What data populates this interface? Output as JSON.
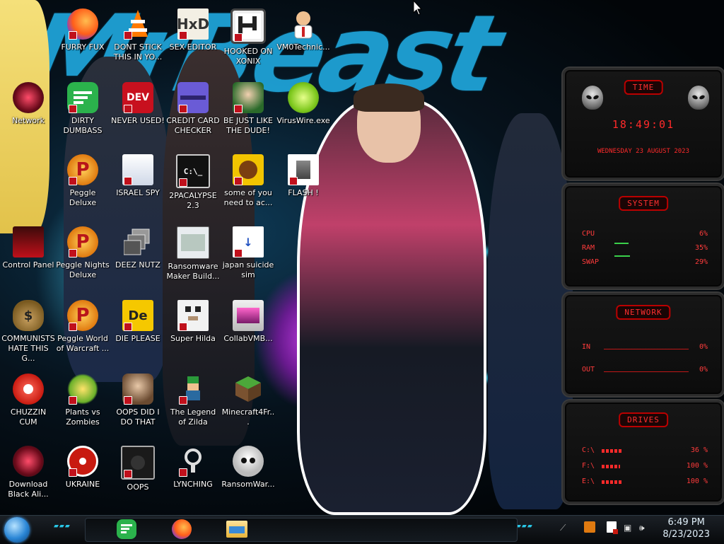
{
  "desktop": {
    "icons": [
      {
        "id": "furry-fux",
        "label": "FURRY FUX"
      },
      {
        "id": "dont-stick",
        "label": "DONT STICK THIS IN YO..."
      },
      {
        "id": "sex-editor",
        "label": "SEX EDITOR"
      },
      {
        "id": "hooked-on-xonix",
        "label": "HOOKED ON XONIX"
      },
      {
        "id": "vm0technic",
        "label": "VM0Technic..."
      },
      {
        "id": "network",
        "label": "Network"
      },
      {
        "id": "dirty-dumbass",
        "label": "DIRTY DUMBASS"
      },
      {
        "id": "never-used",
        "label": "NEVER USED!"
      },
      {
        "id": "credit-card-checker",
        "label": "CREDIT CARD CHECKER"
      },
      {
        "id": "be-just-like-the-dude",
        "label": "BE JUST LIKE THE DUDE!"
      },
      {
        "id": "viruswire",
        "label": "VirusWire.exe"
      },
      {
        "id": "peggle-deluxe",
        "label": "Peggle Deluxe"
      },
      {
        "id": "israel-spy",
        "label": "ISRAEL SPY"
      },
      {
        "id": "2pacalypse",
        "label": "2PACALYPSE 2.3"
      },
      {
        "id": "some-of-you",
        "label": "some of you need to ac..."
      },
      {
        "id": "flash",
        "label": "FLASH !"
      },
      {
        "id": "control-panel",
        "label": "Control Panel"
      },
      {
        "id": "peggle-nights",
        "label": "Peggle Nights Deluxe"
      },
      {
        "id": "deez-nutz",
        "label": "DEEZ NUTZ"
      },
      {
        "id": "ransomware-maker",
        "label": "Ransomware Maker Build..."
      },
      {
        "id": "japan-suicide-sim",
        "label": "japan suicide sim"
      },
      {
        "id": "communists",
        "label": "COMMUNISTS HATE THIS G..."
      },
      {
        "id": "peggle-world",
        "label": "Peggle World of Warcraft ..."
      },
      {
        "id": "die-please",
        "label": "DIE PLEASE"
      },
      {
        "id": "super-hilda",
        "label": "Super Hilda"
      },
      {
        "id": "collabvmb",
        "label": "CollabVMB..."
      },
      {
        "id": "chuzzin-cum",
        "label": "CHUZZIN CUM"
      },
      {
        "id": "plants-vs-zombies",
        "label": "Plants vs Zombies"
      },
      {
        "id": "oops-did-i",
        "label": "OOPS DID I DO THAT"
      },
      {
        "id": "legend-of-zilda",
        "label": "The Legend of Zilda"
      },
      {
        "id": "minecraft4fr",
        "label": "Minecraft4Fr..."
      },
      {
        "id": "download-black-ali",
        "label": "Download Black Ali..."
      },
      {
        "id": "ukraine",
        "label": "UKRAINE"
      },
      {
        "id": "oops",
        "label": "OOPS"
      },
      {
        "id": "lynching",
        "label": "LYNCHING"
      },
      {
        "id": "ransomwar",
        "label": "RansomWar..."
      }
    ]
  },
  "widgets": {
    "time": {
      "title": "TIME",
      "clock": "18:49:01",
      "date": "WEDNESDAY 23 AUGUST 2023"
    },
    "system": {
      "title": "SYSTEM",
      "rows": [
        {
          "label": "CPU",
          "value": "6%"
        },
        {
          "label": "RAM",
          "value": "35%"
        },
        {
          "label": "SWAP",
          "value": "29%"
        }
      ]
    },
    "network": {
      "title": "NETWORK",
      "rows": [
        {
          "label": "IN",
          "value": "0%"
        },
        {
          "label": "OUT",
          "value": "0%"
        }
      ]
    },
    "drives": {
      "title": "DRIVES",
      "rows": [
        {
          "label": "C:\\",
          "value": "36 %"
        },
        {
          "label": "F:\\",
          "value": "100 %"
        },
        {
          "label": "E:\\",
          "value": "100 %"
        }
      ]
    }
  },
  "taskbar": {
    "apps": [
      {
        "name": "feedly"
      },
      {
        "name": "firefox"
      },
      {
        "name": "file-explorer"
      }
    ],
    "time": "6:49 PM",
    "date": "8/23/2023"
  },
  "colors": {
    "accent": "#ff2a2a",
    "wallpaper_blue": "#1fa2d6",
    "taskbar": "#0b0f13"
  }
}
